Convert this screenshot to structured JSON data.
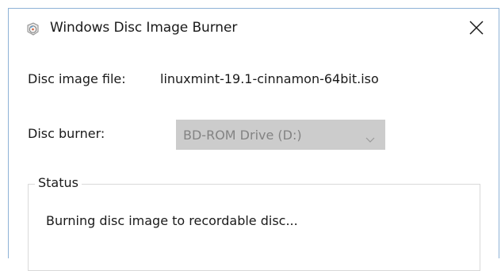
{
  "window": {
    "title": "Windows Disc Image Burner",
    "icon": "disc-burner-app-icon"
  },
  "file": {
    "label": "Disc image file:",
    "value": "linuxmint-19.1-cinnamon-64bit.iso"
  },
  "burner": {
    "label": "Disc burner:",
    "selected": "BD-ROM Drive (D:)",
    "disabled": true
  },
  "status": {
    "legend": "Status",
    "message": "Burning disc image to recordable disc..."
  },
  "colors": {
    "window_border": "#8db2d6",
    "disabled_select_bg": "#cccccc",
    "disabled_text": "#838383"
  }
}
